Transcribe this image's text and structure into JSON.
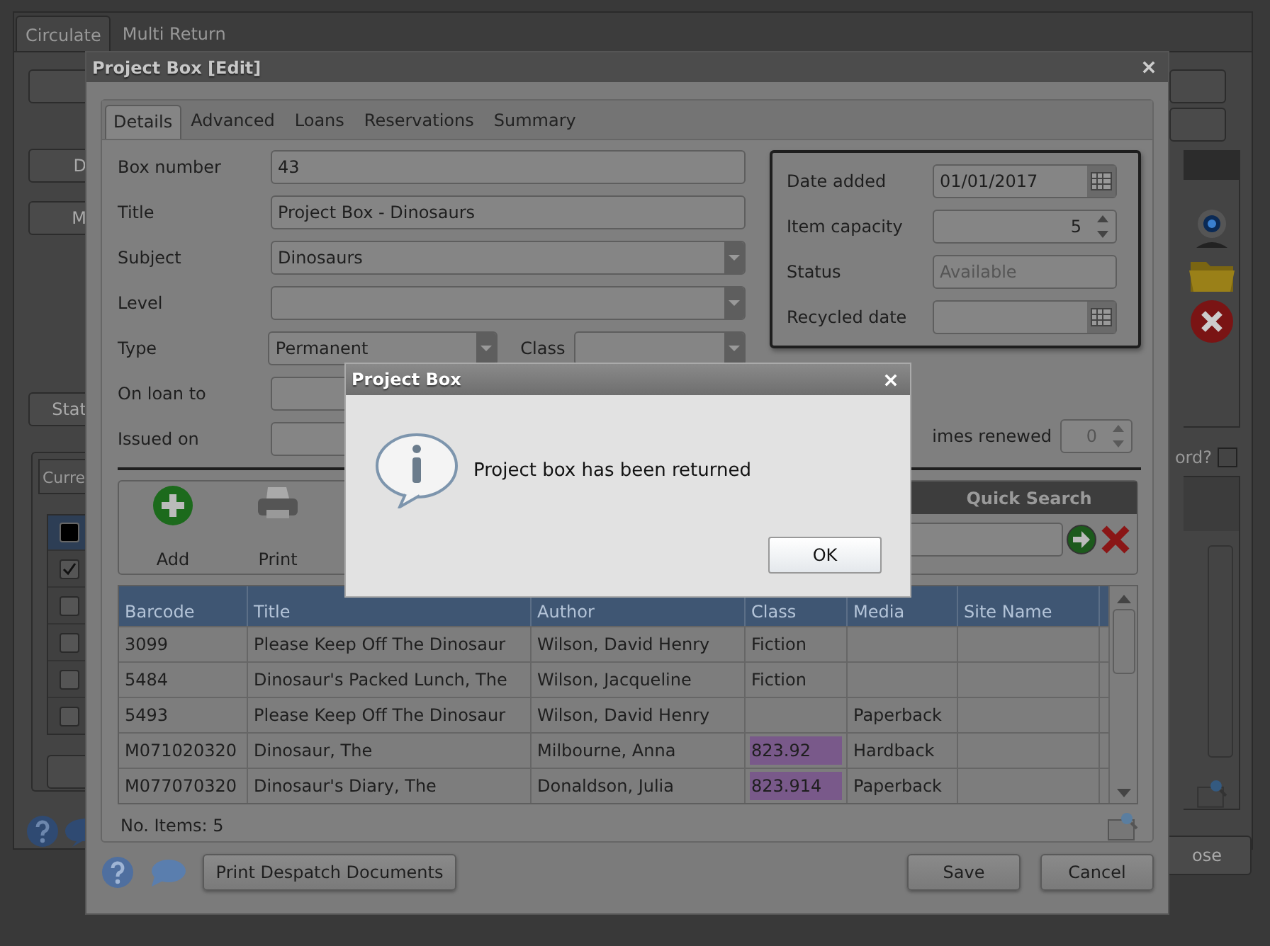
{
  "app": {
    "tabs": [
      {
        "label": "Circulate",
        "selected": true
      },
      {
        "label": "Multi Return",
        "selected": false
      }
    ],
    "left_buttons": [
      "D",
      "M",
      "Stat"
    ],
    "lower_tab": "Curre",
    "select_all": {
      "checked": true
    },
    "list_rows": [
      {
        "checked": true
      },
      {
        "checked": false
      },
      {
        "checked": false
      },
      {
        "checked": false
      },
      {
        "checked": false
      }
    ],
    "option": {
      "label": "ord?",
      "checked": false
    },
    "close_button": "ose"
  },
  "edit_dialog": {
    "title": "Project Box [Edit]",
    "tabs": [
      {
        "label": "Details",
        "selected": true
      },
      {
        "label": "Advanced",
        "selected": false
      },
      {
        "label": "Loans",
        "selected": false
      },
      {
        "label": "Reservations",
        "selected": false
      },
      {
        "label": "Summary",
        "selected": false
      }
    ],
    "fields": [
      {
        "label": "Box number",
        "kind": "text",
        "value": "43"
      },
      {
        "label": "Title",
        "kind": "text",
        "value": "Project Box - Dinosaurs"
      },
      {
        "label": "Subject",
        "kind": "select",
        "value": "Dinosaurs"
      },
      {
        "label": "Level",
        "kind": "select"
      },
      {
        "label": "Type",
        "kind": "type",
        "value": "Permanent"
      },
      {
        "label": "On loan to",
        "kind": "short"
      },
      {
        "label": "Issued on",
        "kind": "short"
      }
    ],
    "class_label": "Class",
    "times_renewed": {
      "label": "imes renewed",
      "value": "0",
      "disabled": true
    },
    "side_fields": [
      {
        "label": "Date added",
        "kind": "date",
        "value": "01/01/2017"
      },
      {
        "label": "Item capacity",
        "kind": "spinner",
        "value": "5"
      },
      {
        "label": "Status",
        "kind": "text",
        "value": "Available",
        "disabled": true
      },
      {
        "label": "Recycled date",
        "kind": "date"
      }
    ],
    "toolbar": [
      "Add",
      "Print"
    ],
    "quick_search": {
      "title": "Quick Search"
    },
    "table": {
      "columns": [
        "Barcode",
        "Title",
        "Author",
        "Class",
        "Media",
        "Site Name"
      ],
      "rows": [
        {
          "cells": [
            "3099",
            "Please Keep Off The Dinosaur",
            "Wilson, David Henry",
            "Fiction",
            "",
            ""
          ],
          "class_highlighted": false
        },
        {
          "cells": [
            "5484",
            "Dinosaur's Packed Lunch, The",
            "Wilson, Jacqueline",
            "Fiction",
            "",
            ""
          ],
          "class_highlighted": false
        },
        {
          "cells": [
            "5493",
            "Please Keep Off The Dinosaur",
            "Wilson, David Henry",
            "",
            "Paperback",
            ""
          ],
          "class_highlighted": false
        },
        {
          "cells": [
            "M071020320",
            "Dinosaur, The",
            "Milbourne, Anna",
            "823.92",
            "Hardback",
            ""
          ],
          "class_highlighted": true
        },
        {
          "cells": [
            "M077070320",
            "Dinosaur's Diary, The",
            "Donaldson, Julia",
            "823.914",
            "Paperback",
            ""
          ],
          "class_highlighted": true
        }
      ]
    },
    "item_count": "No. Items: 5",
    "buttons": {
      "print": "Print Despatch Documents",
      "save": "Save",
      "cancel": "Cancel"
    }
  },
  "message_box": {
    "title": "Project Box",
    "message": "Project box has been returned",
    "button": "OK"
  }
}
